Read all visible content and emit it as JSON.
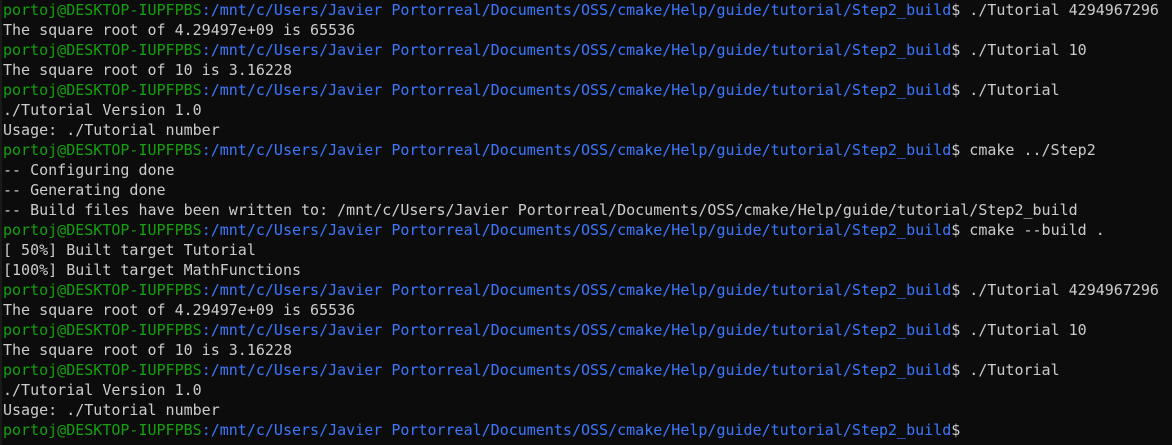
{
  "terminal": {
    "user_host": "portoj@DESKTOP-IUPFPBS",
    "path": ":/mnt/c/Users/Javier Portorreal/Documents/OSS/cmake/Help/guide/tutorial/Step2_build",
    "prompt_symbol": "$",
    "colors": {
      "background": "#0c0c0c",
      "text": "#cccccc",
      "user_host": "#13a10e",
      "path": "#3b78ff"
    },
    "lines": [
      {
        "kind": "prompt",
        "command": " ./Tutorial 4294967296"
      },
      {
        "kind": "output",
        "text": "The square root of 4.29497e+09 is 65536"
      },
      {
        "kind": "prompt",
        "command": " ./Tutorial 10"
      },
      {
        "kind": "output",
        "text": "The square root of 10 is 3.16228"
      },
      {
        "kind": "prompt",
        "command": " ./Tutorial"
      },
      {
        "kind": "output",
        "text": "./Tutorial Version 1.0"
      },
      {
        "kind": "output",
        "text": "Usage: ./Tutorial number"
      },
      {
        "kind": "prompt",
        "command": " cmake ../Step2"
      },
      {
        "kind": "output",
        "text": "-- Configuring done"
      },
      {
        "kind": "output",
        "text": "-- Generating done"
      },
      {
        "kind": "output",
        "text": "-- Build files have been written to: /mnt/c/Users/Javier Portorreal/Documents/OSS/cmake/Help/guide/tutorial/Step2_build"
      },
      {
        "kind": "prompt",
        "command": " cmake --build ."
      },
      {
        "kind": "output",
        "text": "[ 50%] Built target Tutorial"
      },
      {
        "kind": "output",
        "text": "[100%] Built target MathFunctions"
      },
      {
        "kind": "prompt",
        "command": " ./Tutorial 4294967296"
      },
      {
        "kind": "output",
        "text": "The square root of 4.29497e+09 is 65536"
      },
      {
        "kind": "prompt",
        "command": " ./Tutorial 10"
      },
      {
        "kind": "output",
        "text": "The square root of 10 is 3.16228"
      },
      {
        "kind": "prompt",
        "command": " ./Tutorial"
      },
      {
        "kind": "output",
        "text": "./Tutorial Version 1.0"
      },
      {
        "kind": "output",
        "text": "Usage: ./Tutorial number"
      },
      {
        "kind": "prompt",
        "command": ""
      }
    ]
  }
}
